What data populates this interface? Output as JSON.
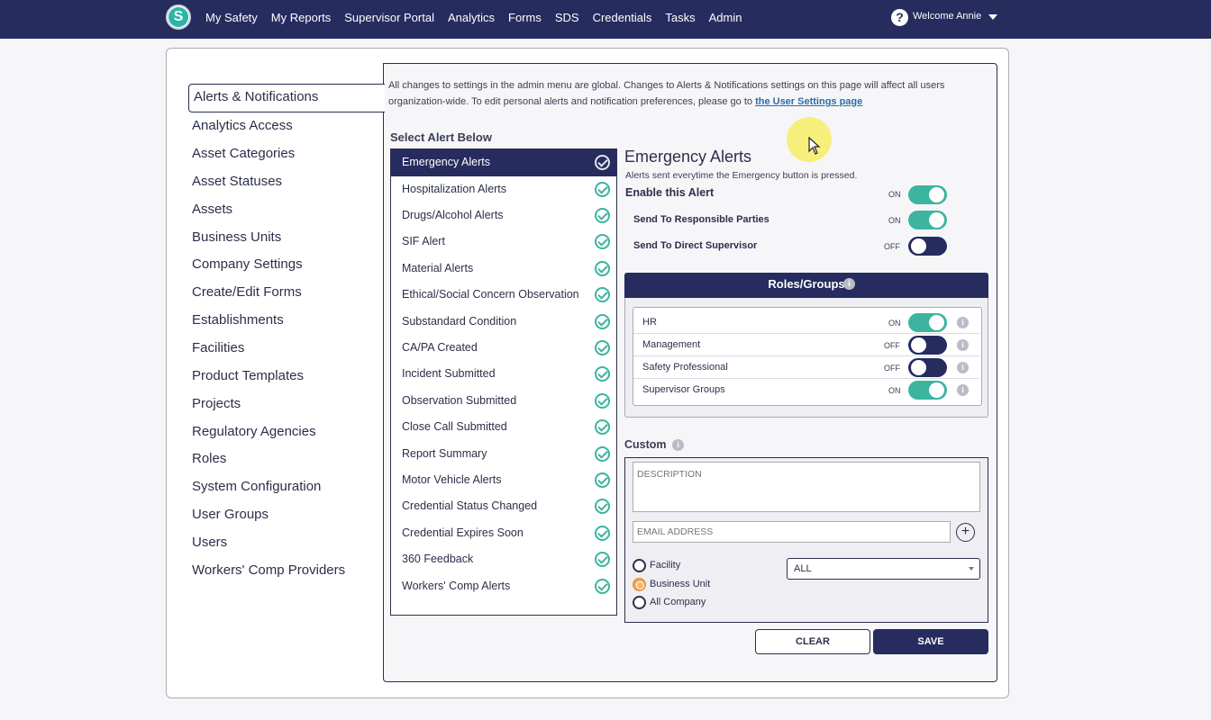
{
  "nav": {
    "logo_letter": "S",
    "links": [
      "My Safety",
      "My Reports",
      "Supervisor Portal",
      "Analytics",
      "Forms",
      "SDS",
      "Credentials",
      "Tasks",
      "Admin"
    ],
    "help_glyph": "?",
    "welcome": "Welcome Annie"
  },
  "menu": {
    "items": [
      "Alerts & Notifications",
      "Analytics Access",
      "Asset Categories",
      "Asset Statuses",
      "Assets",
      "Business Units",
      "Company Settings",
      "Create/Edit Forms",
      "Establishments",
      "Facilities",
      "Product Templates",
      "Projects",
      "Regulatory Agencies",
      "Roles",
      "System Configuration",
      "User Groups",
      "Users",
      "Workers' Comp Providers"
    ],
    "active_index": 0
  },
  "notice": {
    "text": "All changes to settings in the admin menu are global. Changes to Alerts & Notifications settings on this page will affect all users organization-wide. To edit personal alerts and notification preferences, please go to ",
    "link": "the User Settings page"
  },
  "alerts": {
    "title": "Select Alert Below",
    "items": [
      "Emergency Alerts",
      "Hospitalization Alerts",
      "Drugs/Alcohol Alerts",
      "SIF Alert",
      "Material Alerts",
      "Ethical/Social Concern Observation",
      "Substandard Condition",
      "CA/PA Created",
      "Incident Submitted",
      "Observation Submitted",
      "Close Call Submitted",
      "Report Summary",
      "Motor Vehicle Alerts",
      "Credential Status Changed",
      "Credential Expires Soon",
      "360 Feedback",
      "Workers' Comp Alerts"
    ],
    "active_index": 0
  },
  "detail": {
    "title": "Emergency Alerts",
    "description": "Alerts sent everytime the Emergency button is pressed.",
    "enable": {
      "label": "Enable this Alert",
      "state": "ON",
      "on": true
    },
    "responsible": {
      "label": "Send To Responsible Parties",
      "state": "ON",
      "on": true
    },
    "supervisor": {
      "label": "Send To Direct Supervisor",
      "state": "OFF",
      "on": false
    }
  },
  "roles": {
    "title": "Roles/Groups",
    "info_glyph": "i",
    "rows": [
      {
        "name": "HR",
        "state": "ON",
        "on": true
      },
      {
        "name": "Management",
        "state": "OFF",
        "on": false
      },
      {
        "name": "Safety Professional",
        "state": "OFF",
        "on": false
      },
      {
        "name": "Supervisor Groups",
        "state": "ON",
        "on": true
      }
    ]
  },
  "custom": {
    "title": "Custom",
    "description_placeholder": "DESCRIPTION",
    "email_placeholder": "EMAIL ADDRESS",
    "plus_glyph": "+",
    "scope_options": [
      "Facility",
      "Business Unit",
      "All Company"
    ],
    "scope_selected_index": 1,
    "select_value": "ALL"
  },
  "buttons": {
    "clear": "CLEAR",
    "save": "SAVE"
  },
  "colors": {
    "navy": "#262c5e",
    "teal": "#3cb4a0",
    "orange": "#e8913b",
    "link": "#2b6ea8"
  }
}
